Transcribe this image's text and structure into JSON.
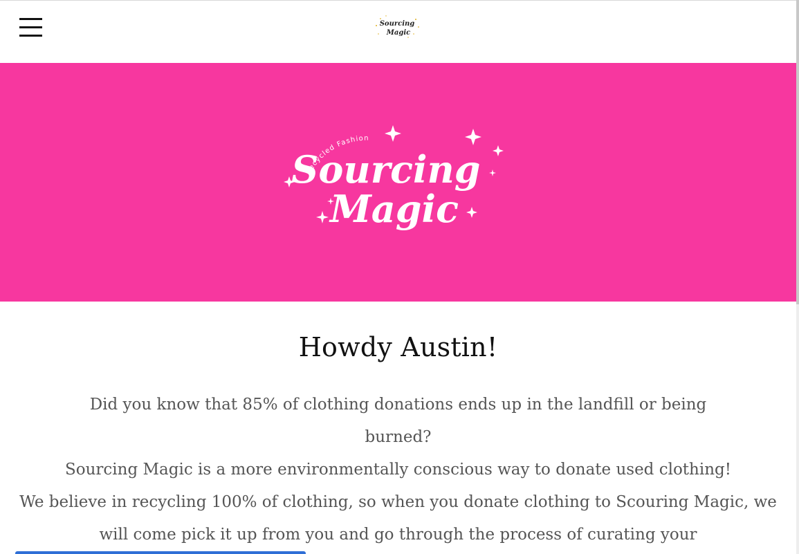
{
  "header": {
    "menu_icon": "hamburger-menu-icon",
    "logo": {
      "line1": "Sourcing",
      "line2": "Magic"
    }
  },
  "hero": {
    "background_color": "#f7379f",
    "logo": {
      "tagline": "Recycled Fashion",
      "line1": "Sourcing",
      "line2": "Magic"
    }
  },
  "main": {
    "heading": "Howdy Austin!",
    "paragraph_1": "Did you know that 85% of clothing donations ends up in the landfill or being burned?",
    "paragraph_2": "Sourcing Magic is a more environmentally conscious way to donate used clothing!",
    "paragraph_3": "We believe in recycling 100% of clothing, so when you donate clothing to Scouring Magic, we will come pick it up from you and go through the process of curating your"
  }
}
